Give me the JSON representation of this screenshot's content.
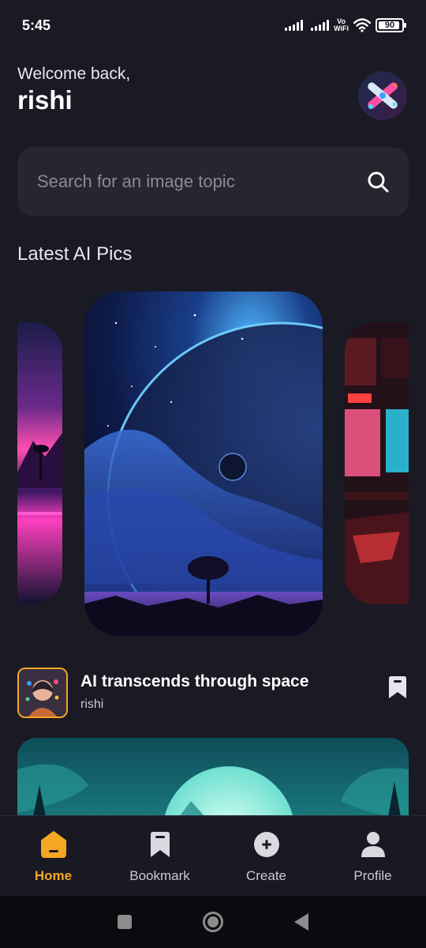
{
  "status_bar": {
    "time": "5:45",
    "vowifi_top": "Vo",
    "vowifi_bottom": "WiFi",
    "battery": "90"
  },
  "header": {
    "welcome": "Welcome back,",
    "username": "rishi"
  },
  "search": {
    "placeholder": "Search for an image topic"
  },
  "section": {
    "title": "Latest AI Pics"
  },
  "featured_post": {
    "title": "AI transcends through space",
    "author": "rishi"
  },
  "nav": {
    "items": [
      {
        "label": "Home",
        "icon": "home-icon",
        "active": true
      },
      {
        "label": "Bookmark",
        "icon": "bookmark-icon",
        "active": false
      },
      {
        "label": "Create",
        "icon": "plus-circle-icon",
        "active": false
      },
      {
        "label": "Profile",
        "icon": "person-icon",
        "active": false
      }
    ]
  },
  "colors": {
    "background": "#1a1a24",
    "surface": "#262631",
    "accent": "#f5a623",
    "muted_text": "#8a8a98"
  }
}
